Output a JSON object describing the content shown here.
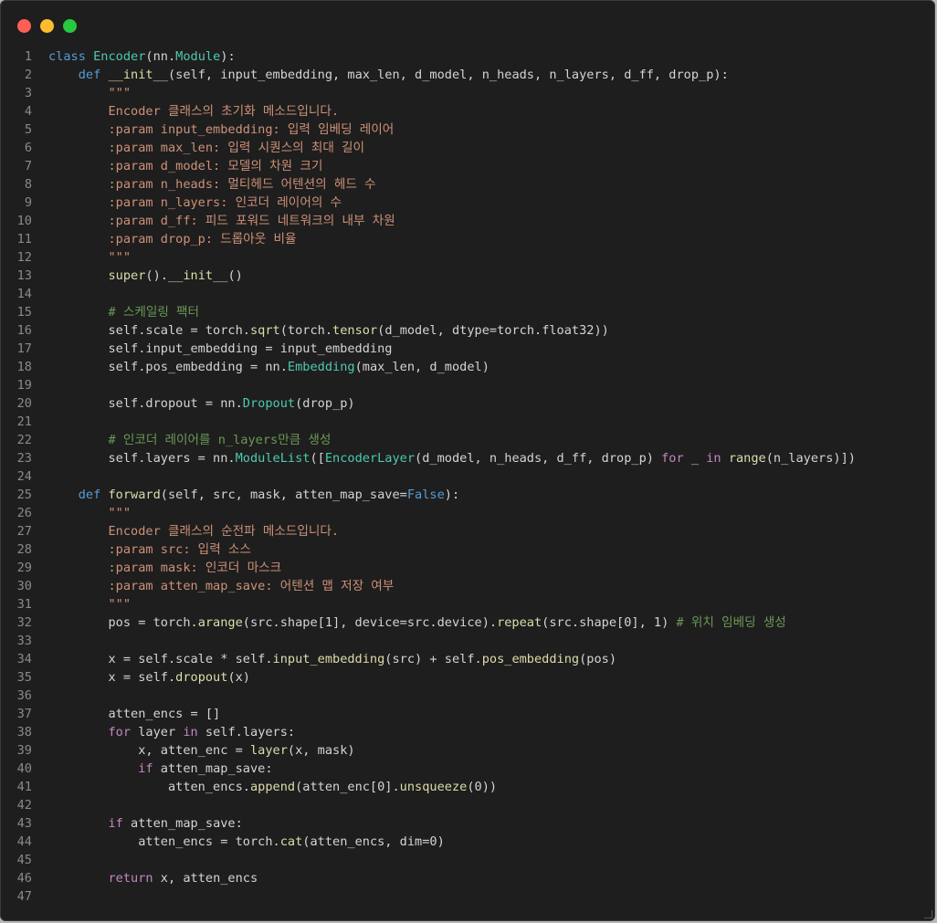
{
  "window": {
    "controls": [
      "close",
      "minimize",
      "maximize"
    ],
    "colors": {
      "close": "#ff5f57",
      "minimize": "#febc2e",
      "maximize": "#28c840",
      "background": "#1e1e1e"
    }
  },
  "code": {
    "language": "python",
    "lines": [
      [
        {
          "t": "class ",
          "c": "kw"
        },
        {
          "t": "Encoder",
          "c": "cls"
        },
        {
          "t": "(nn.",
          "c": "p"
        },
        {
          "t": "Module",
          "c": "cls"
        },
        {
          "t": "):",
          "c": "p"
        }
      ],
      [
        {
          "t": "    def ",
          "c": "kw"
        },
        {
          "t": "__init__",
          "c": "fn"
        },
        {
          "t": "(self, input_embedding, max_len, d_model, n_heads, n_layers, d_ff, drop_p):",
          "c": "p"
        }
      ],
      [
        {
          "t": "        \"\"\"",
          "c": "str"
        }
      ],
      [
        {
          "t": "        Encoder 클래스의 초기화 메소드입니다.",
          "c": "str"
        }
      ],
      [
        {
          "t": "        :param input_embedding: 입력 임베딩 레이어",
          "c": "str"
        }
      ],
      [
        {
          "t": "        :param max_len: 입력 시퀀스의 최대 길이",
          "c": "str"
        }
      ],
      [
        {
          "t": "        :param d_model: 모델의 차원 크기",
          "c": "str"
        }
      ],
      [
        {
          "t": "        :param n_heads: 멀티헤드 어텐션의 헤드 수",
          "c": "str"
        }
      ],
      [
        {
          "t": "        :param n_layers: 인코더 레이어의 수",
          "c": "str"
        }
      ],
      [
        {
          "t": "        :param d_ff: 피드 포워드 네트워크의 내부 차원",
          "c": "str"
        }
      ],
      [
        {
          "t": "        :param drop_p: 드롭아웃 비율",
          "c": "str"
        }
      ],
      [
        {
          "t": "        \"\"\"",
          "c": "str"
        }
      ],
      [
        {
          "t": "        ",
          "c": "p"
        },
        {
          "t": "super",
          "c": "fn"
        },
        {
          "t": "().",
          "c": "p"
        },
        {
          "t": "__init__",
          "c": "fn"
        },
        {
          "t": "()",
          "c": "p"
        }
      ],
      [],
      [
        {
          "t": "        # 스케일링 팩터",
          "c": "cm"
        }
      ],
      [
        {
          "t": "        self.scale = torch.",
          "c": "p"
        },
        {
          "t": "sqrt",
          "c": "fn"
        },
        {
          "t": "(torch.",
          "c": "p"
        },
        {
          "t": "tensor",
          "c": "fn"
        },
        {
          "t": "(d_model, dtype=torch.float32))",
          "c": "p"
        }
      ],
      [
        {
          "t": "        self.input_embedding = input_embedding",
          "c": "p"
        }
      ],
      [
        {
          "t": "        self.pos_embedding = nn.",
          "c": "p"
        },
        {
          "t": "Embedding",
          "c": "cls"
        },
        {
          "t": "(max_len, d_model)",
          "c": "p"
        }
      ],
      [],
      [
        {
          "t": "        self.dropout = nn.",
          "c": "p"
        },
        {
          "t": "Dropout",
          "c": "cls"
        },
        {
          "t": "(drop_p)",
          "c": "p"
        }
      ],
      [],
      [
        {
          "t": "        # 인코더 레이어를 n_layers만큼 생성",
          "c": "cm"
        }
      ],
      [
        {
          "t": "        self.layers = nn.",
          "c": "p"
        },
        {
          "t": "ModuleList",
          "c": "cls"
        },
        {
          "t": "([",
          "c": "p"
        },
        {
          "t": "EncoderLayer",
          "c": "cls"
        },
        {
          "t": "(d_model, n_heads, d_ff, drop_p) ",
          "c": "p"
        },
        {
          "t": "for",
          "c": "kp"
        },
        {
          "t": " _ ",
          "c": "p"
        },
        {
          "t": "in",
          "c": "kp"
        },
        {
          "t": " ",
          "c": "p"
        },
        {
          "t": "range",
          "c": "fn"
        },
        {
          "t": "(n_layers)])",
          "c": "p"
        }
      ],
      [],
      [
        {
          "t": "    def ",
          "c": "kw"
        },
        {
          "t": "forward",
          "c": "fn"
        },
        {
          "t": "(self, src, mask, atten_map_save=",
          "c": "p"
        },
        {
          "t": "False",
          "c": "kw"
        },
        {
          "t": "):",
          "c": "p"
        }
      ],
      [
        {
          "t": "        \"\"\"",
          "c": "str"
        }
      ],
      [
        {
          "t": "        Encoder 클래스의 순전파 메소드입니다.",
          "c": "str"
        }
      ],
      [
        {
          "t": "        :param src: 입력 소스",
          "c": "str"
        }
      ],
      [
        {
          "t": "        :param mask: 인코더 마스크",
          "c": "str"
        }
      ],
      [
        {
          "t": "        :param atten_map_save: 어텐션 맵 저장 여부",
          "c": "str"
        }
      ],
      [
        {
          "t": "        \"\"\"",
          "c": "str"
        }
      ],
      [
        {
          "t": "        pos = torch.",
          "c": "p"
        },
        {
          "t": "arange",
          "c": "fn"
        },
        {
          "t": "(src.shape[1], device=src.device).",
          "c": "p"
        },
        {
          "t": "repeat",
          "c": "fn"
        },
        {
          "t": "(src.shape[0], 1) ",
          "c": "p"
        },
        {
          "t": "# 위치 임베딩 생성",
          "c": "cm"
        }
      ],
      [],
      [
        {
          "t": "        x = self.scale * self.",
          "c": "p"
        },
        {
          "t": "input_embedding",
          "c": "fn"
        },
        {
          "t": "(src) + self.",
          "c": "p"
        },
        {
          "t": "pos_embedding",
          "c": "fn"
        },
        {
          "t": "(pos)",
          "c": "p"
        }
      ],
      [
        {
          "t": "        x = self.",
          "c": "p"
        },
        {
          "t": "dropout",
          "c": "fn"
        },
        {
          "t": "(x)",
          "c": "p"
        }
      ],
      [],
      [
        {
          "t": "        atten_encs = []",
          "c": "p"
        }
      ],
      [
        {
          "t": "        ",
          "c": "p"
        },
        {
          "t": "for",
          "c": "kp"
        },
        {
          "t": " layer ",
          "c": "p"
        },
        {
          "t": "in",
          "c": "kp"
        },
        {
          "t": " self.layers:",
          "c": "p"
        }
      ],
      [
        {
          "t": "            x, atten_enc = ",
          "c": "p"
        },
        {
          "t": "layer",
          "c": "fn"
        },
        {
          "t": "(x, mask)",
          "c": "p"
        }
      ],
      [
        {
          "t": "            ",
          "c": "p"
        },
        {
          "t": "if",
          "c": "kp"
        },
        {
          "t": " atten_map_save:",
          "c": "p"
        }
      ],
      [
        {
          "t": "                atten_encs.",
          "c": "p"
        },
        {
          "t": "append",
          "c": "fn"
        },
        {
          "t": "(atten_enc[0].",
          "c": "p"
        },
        {
          "t": "unsqueeze",
          "c": "fn"
        },
        {
          "t": "(0))",
          "c": "p"
        }
      ],
      [],
      [
        {
          "t": "        ",
          "c": "p"
        },
        {
          "t": "if",
          "c": "kp"
        },
        {
          "t": " atten_map_save:",
          "c": "p"
        }
      ],
      [
        {
          "t": "            atten_encs = torch.",
          "c": "p"
        },
        {
          "t": "cat",
          "c": "fn"
        },
        {
          "t": "(atten_encs, dim=0)",
          "c": "p"
        }
      ],
      [],
      [
        {
          "t": "        ",
          "c": "p"
        },
        {
          "t": "return",
          "c": "kp"
        },
        {
          "t": " x, atten_encs",
          "c": "p"
        }
      ],
      []
    ]
  }
}
